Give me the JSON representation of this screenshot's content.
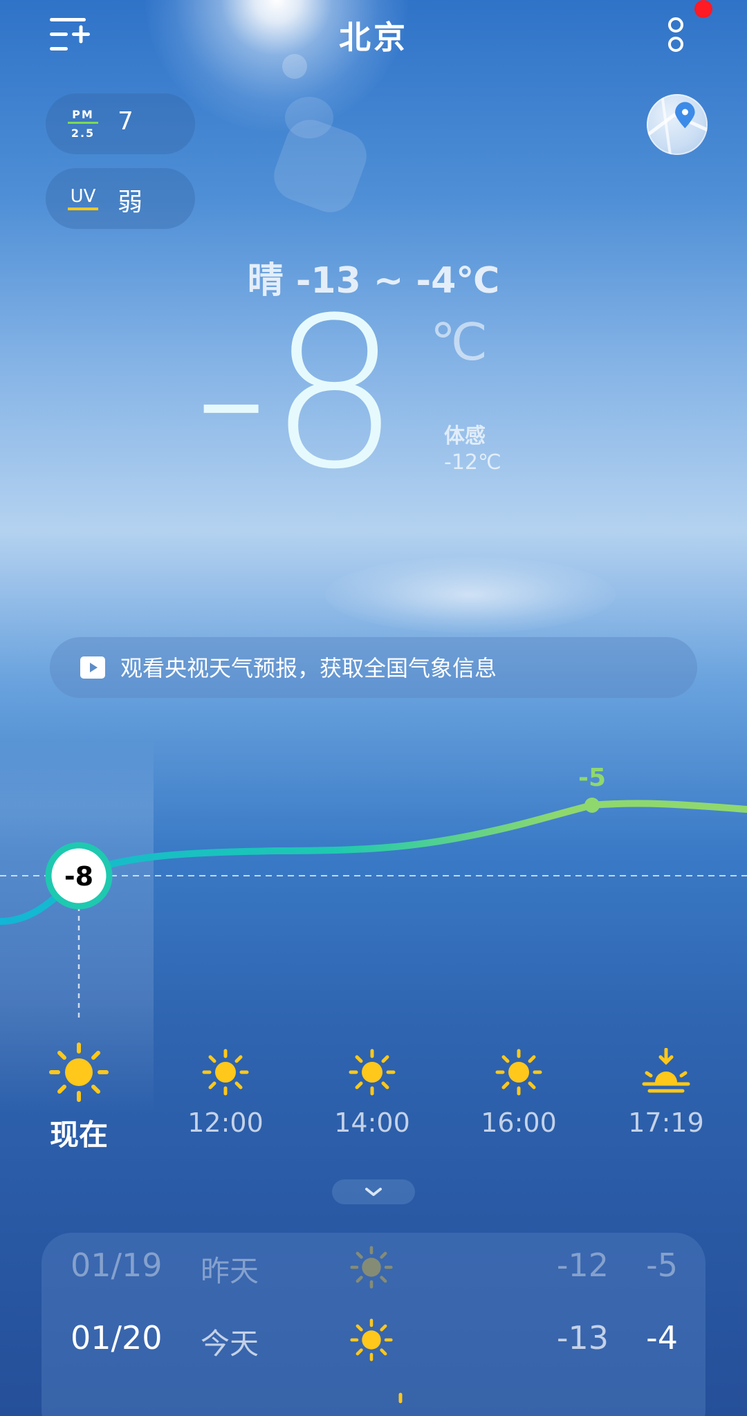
{
  "header": {
    "city": "北京",
    "menu_icon": "menu-add-icon",
    "more_icon": "more-vertical-icon"
  },
  "air": {
    "pm_label_top": "PM",
    "pm_label_bottom": "2.5",
    "pm_value": "7",
    "uv_label": "UV",
    "uv_value": "弱"
  },
  "map_icon": "map-location-icon",
  "current": {
    "condition_line": "晴  -13 ~ -4℃",
    "temperature": "-8",
    "unit": "℃",
    "feels_label": "体感",
    "feels_value": "-12℃"
  },
  "banner": {
    "icon": "play-icon",
    "text": "观看央视天气预报，获取全国气象信息"
  },
  "hourly": {
    "now_value": "-8",
    "peak_value": "-5",
    "items": [
      {
        "label": "现在",
        "icon": "sun-icon"
      },
      {
        "label": "12:00",
        "icon": "sun-icon"
      },
      {
        "label": "14:00",
        "icon": "sun-icon"
      },
      {
        "label": "16:00",
        "icon": "sun-icon"
      },
      {
        "label": "17:19",
        "icon": "sunset-icon"
      }
    ]
  },
  "daily": [
    {
      "date": "01/19",
      "day": "昨天",
      "icon": "sun-icon",
      "low": "-12",
      "high": "-5"
    },
    {
      "date": "01/20",
      "day": "今天",
      "icon": "sun-icon",
      "low": "-13",
      "high": "-4"
    }
  ],
  "colors": {
    "accent_teal": "#1ec9b0",
    "accent_green": "#8fd86e",
    "sun_yellow": "#ffc81a",
    "notify_red": "#ff1a24"
  }
}
